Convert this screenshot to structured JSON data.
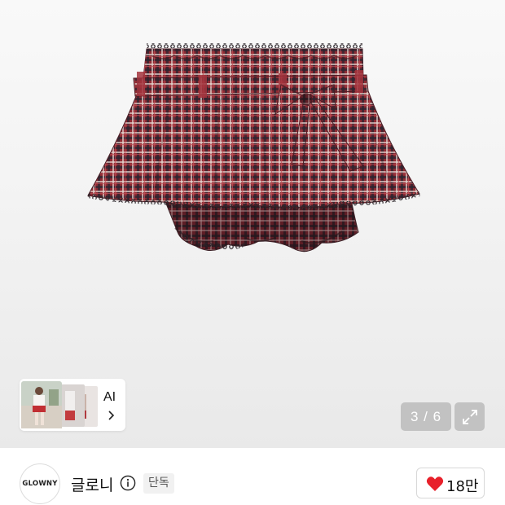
{
  "gallery": {
    "product_image_alt": "",
    "counter": {
      "current": "3",
      "total": "6",
      "display": "3 / 6"
    },
    "fullscreen_icon": "expand-icon",
    "ai_card": {
      "label": "AI",
      "chevron_icon": "chevron-right-icon"
    }
  },
  "seller": {
    "logo_text": "GLOWNY",
    "name": "글로니",
    "info_icon": "info-icon",
    "badge": "단독"
  },
  "like": {
    "icon": "heart-icon",
    "count": "18만",
    "heart_color": "#e8202a"
  },
  "colors": {
    "plaid_red": "#8e2b33",
    "counter_bg": "#aaaaaa"
  }
}
